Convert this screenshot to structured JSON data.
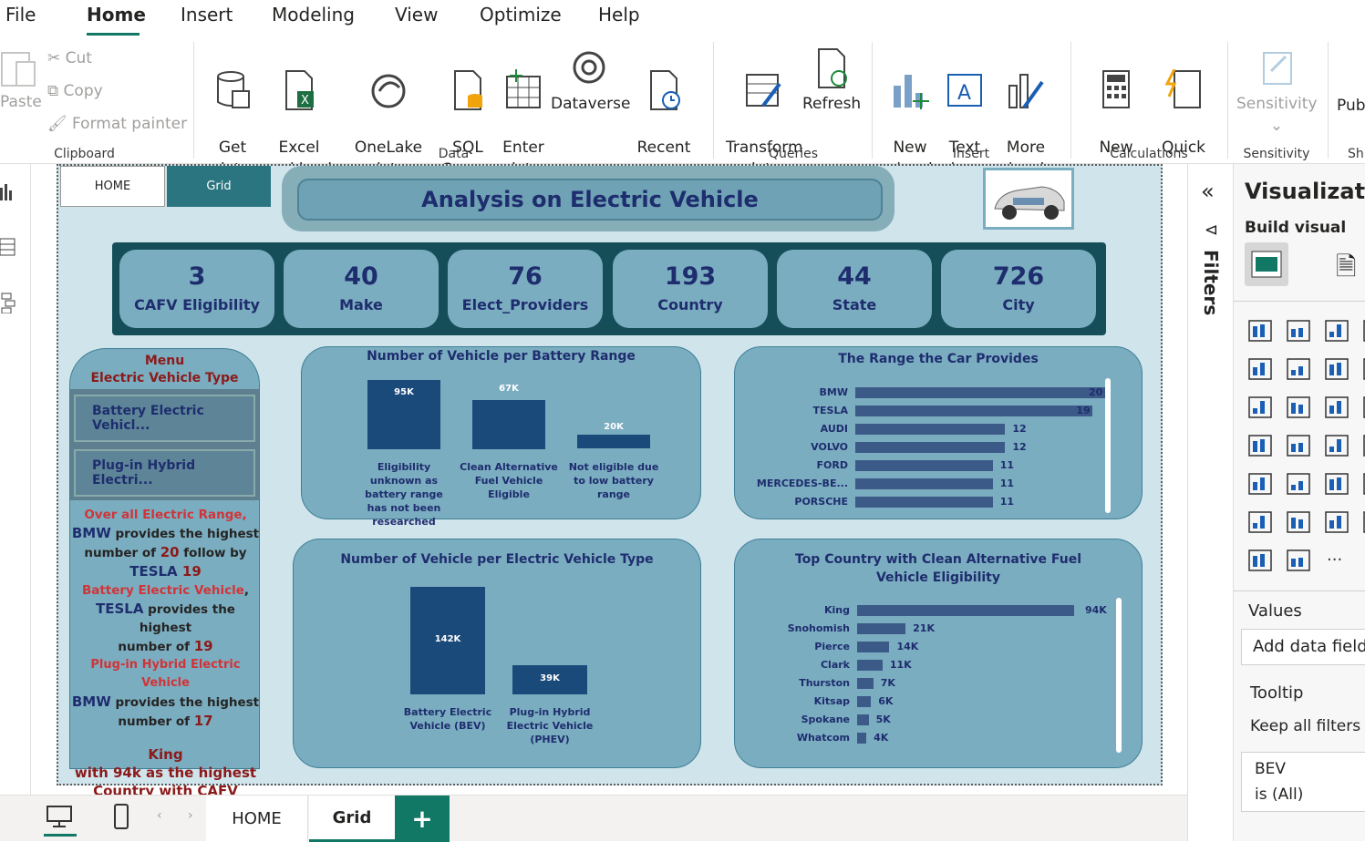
{
  "ribbon_tabs": [
    "File",
    "Home",
    "Insert",
    "Modeling",
    "View",
    "Optimize",
    "Help"
  ],
  "clipboard": {
    "paste": "Paste",
    "cut": "Cut",
    "copy": "Copy",
    "format_painter": "Format painter",
    "group": "Clipboard"
  },
  "data_group": {
    "get_data": "Get\ndata",
    "excel": "Excel\nworkbook",
    "onelake": "OneLake data\nhub",
    "sql": "SQL\nServer",
    "enter": "Enter\ndata",
    "dataverse": "Dataverse",
    "recent": "Recent\nsources",
    "group": "Data"
  },
  "queries": {
    "transform": "Transform\ndata",
    "refresh": "Refresh",
    "group": "Queries"
  },
  "insert": {
    "new_visual": "New\nvisual",
    "text_box": "Text\nbox",
    "more_visuals": "More\nvisuals",
    "group": "Insert"
  },
  "calculations": {
    "new_measure": "New\nmeasure",
    "quick_measure": "Quick\nmeasure",
    "group": "Calculations"
  },
  "sensitivity": {
    "label": "Sensitivity",
    "group": "Sensitivity"
  },
  "publish": {
    "label": "Pub",
    "group": "Sh"
  },
  "report": {
    "nav_home": "HOME",
    "nav_grid": "Grid",
    "title": "Analysis on Electric Vehicle",
    "kpis": [
      {
        "value": "3",
        "label": "CAFV Eligibility"
      },
      {
        "value": "40",
        "label": "Make"
      },
      {
        "value": "76",
        "label": "Elect_Providers"
      },
      {
        "value": "193",
        "label": "Country"
      },
      {
        "value": "44",
        "label": "State"
      },
      {
        "value": "726",
        "label": "City"
      }
    ],
    "menu": {
      "title": "Menu",
      "subtitle": "Electric Vehicle Type",
      "slicer1": "Battery Electric Vehicl...",
      "slicer2": "Plug-in Hybrid Electri..."
    },
    "narrative": {
      "l1": "Over all Electric Range,",
      "l2a": "BMW",
      "l2b": " provides the highest",
      "l3a": "number of ",
      "l3b": "20",
      "l3c": " follow by",
      "l4a": "TESLA ",
      "l4b": "19",
      "l5a": "Battery Electric Vehicle",
      ",": ",",
      "l6a": "TESLA",
      "l6b": " provides the highest",
      "l7": "number of ",
      "l7b": "19",
      "l8": "Plug-in Hybrid Electric Vehicle",
      "l9a": "BMW",
      "l9b": " provides the highest",
      "l10": "number of ",
      "l10b": "17",
      "l11": "King",
      "l12": "with 94k as the highest",
      "l13": "Country with CAFV"
    }
  },
  "chart_data": [
    {
      "type": "bar",
      "title": "Number of Vehicle per Battery Range",
      "categories": [
        "Eligibility unknown as battery range has not been researched",
        "Clean Alternative Fuel Vehicle Eligible",
        "Not eligible due to low battery range"
      ],
      "values": [
        95000,
        67000,
        20000
      ],
      "labels": [
        "95K",
        "67K",
        "20K"
      ]
    },
    {
      "type": "bar",
      "orientation": "horizontal",
      "title": "The Range the Car Provides",
      "categories": [
        "BMW",
        "TESLA",
        "AUDI",
        "VOLVO",
        "FORD",
        "MERCEDES-BE...",
        "PORSCHE"
      ],
      "values": [
        20,
        19,
        12,
        12,
        11,
        11,
        11
      ]
    },
    {
      "type": "bar",
      "title": "Number of Vehicle per Electric Vehicle Type",
      "categories": [
        "Battery Electric Vehicle (BEV)",
        "Plug-in Hybrid Electric Vehicle (PHEV)"
      ],
      "values": [
        142000,
        39000
      ],
      "labels": [
        "142K",
        "39K"
      ]
    },
    {
      "type": "bar",
      "orientation": "horizontal",
      "title": "Top Country with Clean Alternative Fuel Vehicle Eligibility",
      "categories": [
        "King",
        "Snohomish",
        "Pierce",
        "Clark",
        "Thurston",
        "Kitsap",
        "Spokane",
        "Whatcom"
      ],
      "values": [
        94000,
        21000,
        14000,
        11000,
        7000,
        6000,
        5000,
        4000
      ],
      "labels": [
        "94K",
        "21K",
        "14K",
        "11K",
        "7K",
        "6K",
        "5K",
        "4K"
      ]
    }
  ],
  "filters": {
    "label": "Filters"
  },
  "viz_pane": {
    "title": "Visualization",
    "build": "Build visual",
    "values": "Values",
    "add_fields": "Add data fields",
    "tooltip": "Tooltip",
    "keep_filters": "Keep all filters",
    "filter_name": "BEV",
    "filter_value": "is (All)"
  },
  "pages": {
    "home": "HOME",
    "grid": "Grid",
    "add": "+"
  },
  "colors": {
    "accent": "#117865",
    "report_bg": "#d0e4ec",
    "card": "#7badc0",
    "bar": "#1a4a7a",
    "hbar": "#3c5a88",
    "navy": "#1e2d6e",
    "red": "#d13438"
  }
}
